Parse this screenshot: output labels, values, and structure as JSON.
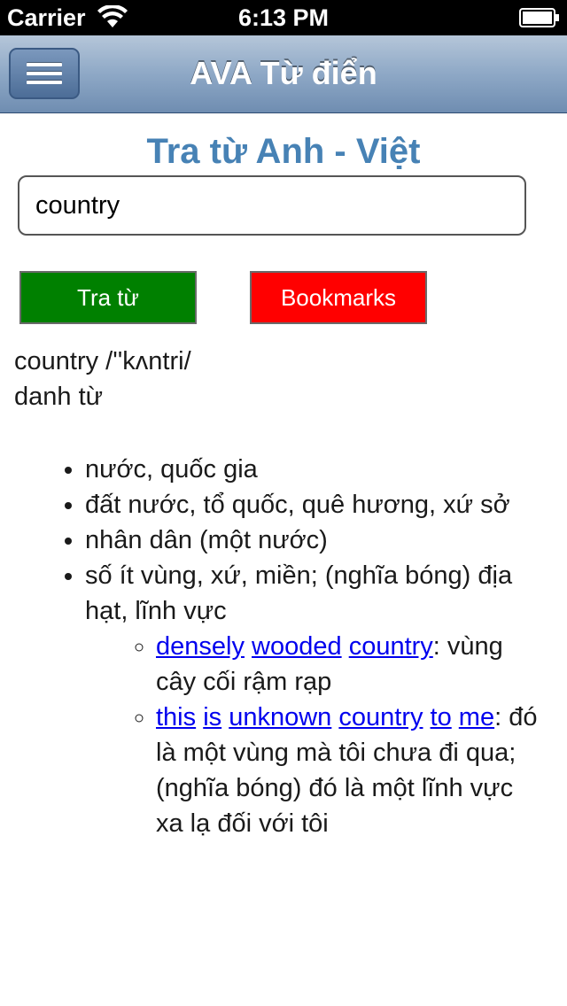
{
  "status_bar": {
    "carrier": "Carrier",
    "time": "6:13 PM",
    "wifi_icon": "wifi-icon",
    "battery_icon": "battery-icon"
  },
  "nav_bar": {
    "menu_icon": "hamburger-menu-icon",
    "title": "AVA Từ điển"
  },
  "page": {
    "title": "Tra từ Anh - Việt"
  },
  "search": {
    "value": "country",
    "placeholder": ""
  },
  "buttons": {
    "lookup_label": "Tra từ",
    "bookmarks_label": "Bookmarks"
  },
  "result": {
    "headword_line": "country /''kʌntri/",
    "part_of_speech": "danh từ",
    "senses": [
      "nước, quốc gia",
      "đất nước, tổ quốc, quê hương, xứ sở",
      "nhân dân (một nước)",
      "số ít vùng, xứ, miền; (nghĩa bóng) địa hạt, lĩnh vực"
    ],
    "examples": [
      {
        "links": [
          "densely",
          "wooded",
          "country"
        ],
        "meaning": ": vùng cây cối rậm rạp"
      },
      {
        "links": [
          "this",
          "is",
          "unknown",
          "country",
          "to",
          "me"
        ],
        "meaning": ": đó là một vùng mà tôi chưa đi qua; (nghĩa bóng) đó là một lĩnh vực xa lạ đối với tôi"
      }
    ]
  },
  "colors": {
    "title_blue": "#4782b5",
    "lookup_button": "#008000",
    "bookmarks_button": "#ff0000",
    "link": "#0000ee"
  }
}
